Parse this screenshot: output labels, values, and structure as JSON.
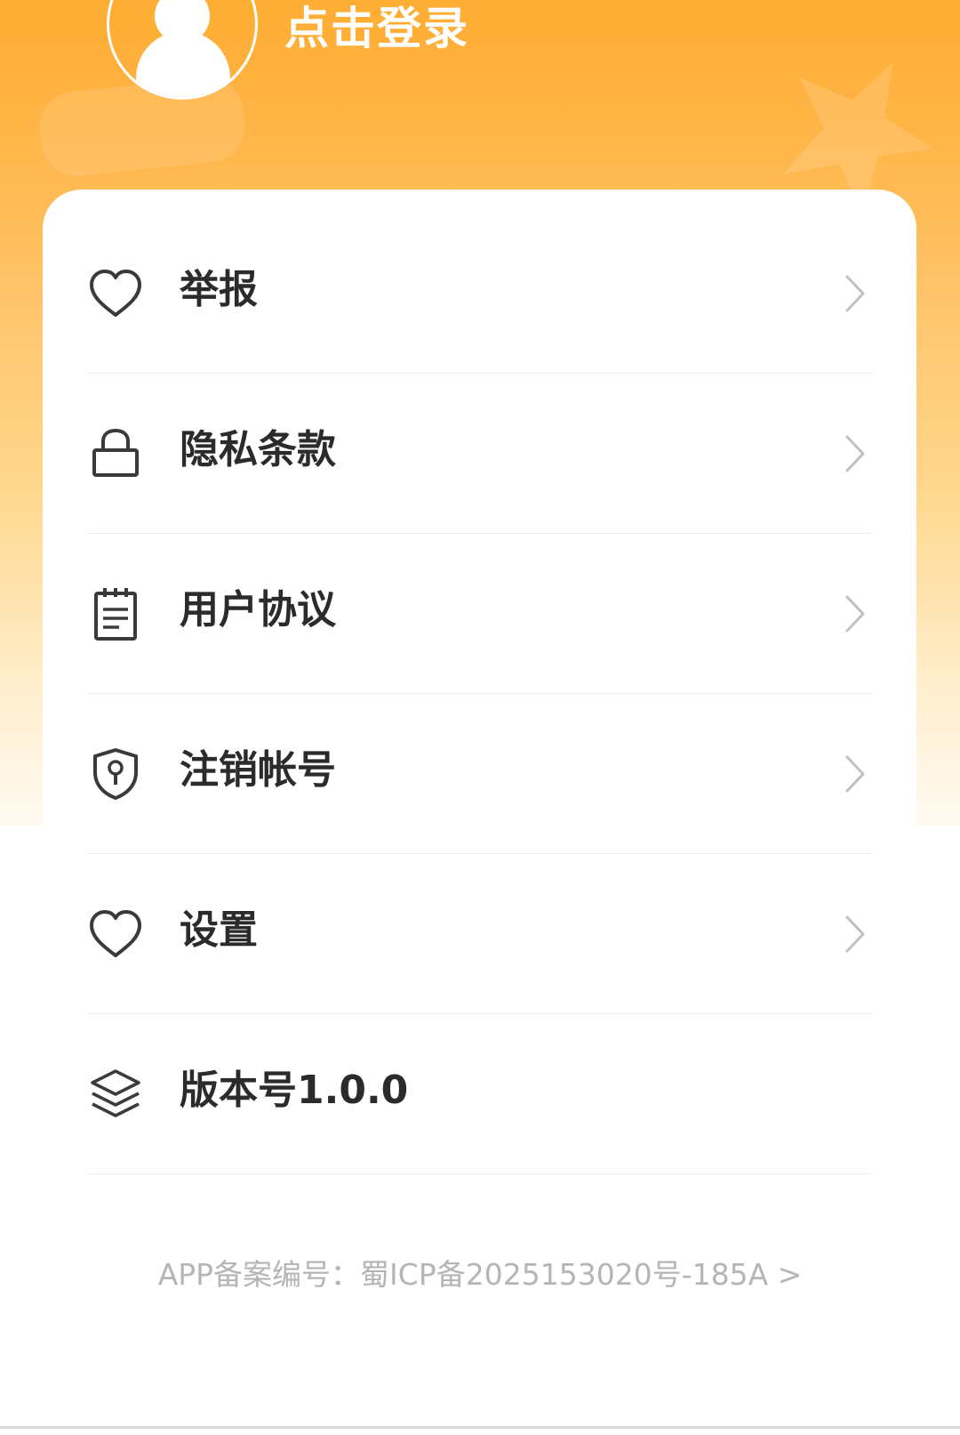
{
  "header": {
    "login_label": "点击登录",
    "accent_color": "#ffad33"
  },
  "menu": {
    "items": [
      {
        "icon": "heart-icon",
        "label": "举报",
        "has_chevron": true
      },
      {
        "icon": "lock-icon",
        "label": "隐私条款",
        "has_chevron": true
      },
      {
        "icon": "document-icon",
        "label": "用户协议",
        "has_chevron": true
      },
      {
        "icon": "shield-icon",
        "label": "注销帐号",
        "has_chevron": true
      },
      {
        "icon": "heart-icon",
        "label": "设置",
        "has_chevron": true
      },
      {
        "icon": "layers-icon",
        "label": "版本号1.0.0",
        "has_chevron": false
      }
    ]
  },
  "footer": {
    "icp_text": "APP备案编号：蜀ICP备2025153020号-185A >"
  }
}
